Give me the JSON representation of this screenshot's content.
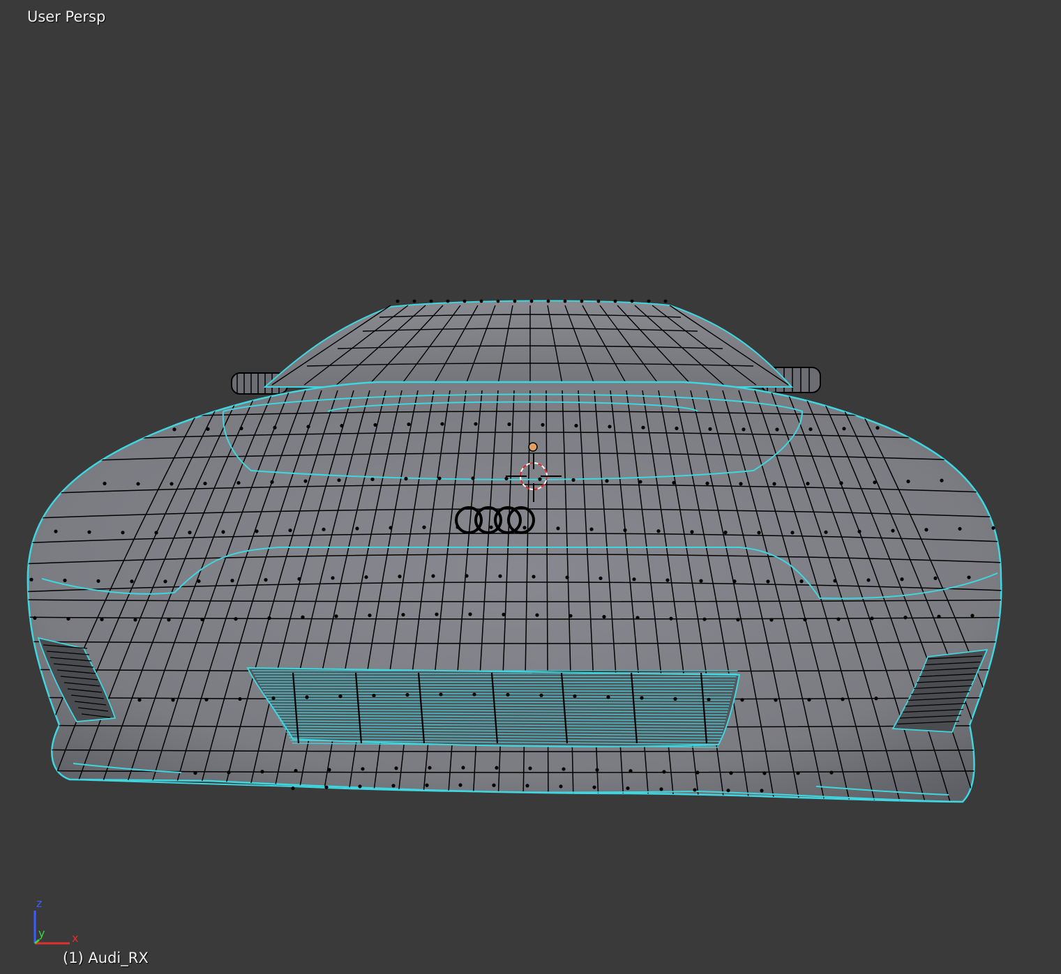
{
  "viewport": {
    "view_label": "User Persp",
    "object_label": "(1) Audi_RX",
    "background": "#3a3a3a"
  },
  "mesh": {
    "face_color": "#7b7c82",
    "wire_color": "#000000",
    "selected_edge_color": "#3fd6e0",
    "icon": "car-front-mesh-icon"
  },
  "cursor": {
    "icon": "3d-cursor-icon",
    "origin_color": "#e0a060"
  },
  "axes": {
    "z": "z",
    "y": "y",
    "x": "x",
    "z_color": "#3b5cff",
    "y_color": "#3fd23f",
    "x_color": "#e03030"
  }
}
